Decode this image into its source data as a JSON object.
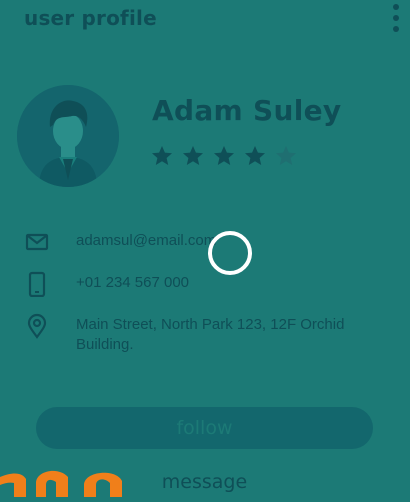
{
  "header": {
    "title": "user profile"
  },
  "profile": {
    "name": "Adam Suley",
    "rating": {
      "value": 4,
      "max": 5
    }
  },
  "contact": {
    "email": "adamsul@email.com",
    "phone": "+01 234 567 000",
    "address": "Main Street, North Park 123, 12F Orchid Building."
  },
  "actions": {
    "follow_label": "follow",
    "message_label": "message"
  },
  "colors": {
    "overlay": "#1c7a76",
    "text_dark": "#0f4f57",
    "button": "#13676d",
    "spinner": "#ffffff",
    "brand_orange": "#f07f1a"
  },
  "icons": {
    "menu": "more-vertical-icon",
    "email": "mail-icon",
    "phone": "phone-icon",
    "address": "location-pin-icon",
    "loading": "loading-spinner-icon"
  }
}
